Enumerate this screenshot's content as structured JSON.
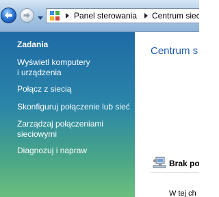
{
  "address_bar": {
    "crumbs": [
      "Panel sterowania",
      "Centrum siec"
    ]
  },
  "taskpane": {
    "heading": "Zadania",
    "links": [
      {
        "line1": "Wyświetl komputery",
        "line2": "i urządzenia"
      },
      {
        "line1": "Połącz z siecią",
        "line2": ""
      },
      {
        "line1": "Skonfiguruj połączenie lub sieć",
        "line2": ""
      },
      {
        "line1": "Zarządzaj połączeniami",
        "line2": "sieciowymi"
      },
      {
        "line1": "Diagnozuj i napraw",
        "line2": ""
      }
    ]
  },
  "main": {
    "title": "Centrum s",
    "status": "Brak po",
    "info": "W tej ch"
  },
  "icons": {
    "back": "back-arrow-icon",
    "forward": "forward-arrow-icon",
    "history": "dropdown-icon",
    "control_panel": "control-panel-icon",
    "network": "network-computer-icon"
  },
  "colors": {
    "taskpane_top": "#1f6aa6",
    "taskpane_bottom": "#6bbf7c",
    "title_blue": "#1e5aa8"
  }
}
